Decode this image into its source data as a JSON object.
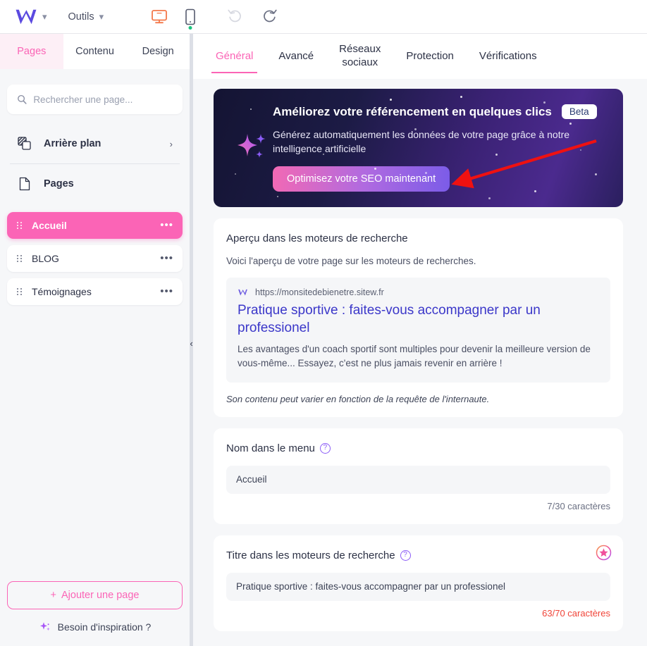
{
  "topbar": {
    "logo": "sitew-w-logo",
    "logo_caret": "⌄",
    "tools_label": "Outils",
    "tools_caret": "⌄",
    "desktop_icon": "desktop-monitor-icon",
    "mobile_icon": "mobile-phone-icon",
    "undo_icon": "undo-arrow-icon",
    "redo_icon": "redo-arrow-icon"
  },
  "sidebar": {
    "tabs": [
      {
        "label": "Pages",
        "active": true
      },
      {
        "label": "Contenu",
        "active": false
      },
      {
        "label": "Design",
        "active": false
      }
    ],
    "search": {
      "placeholder": "Rechercher une page...",
      "value": "",
      "icon": "search-icon"
    },
    "menu": [
      {
        "label": "Arrière plan",
        "icon": "layers-icon",
        "arrow": "›"
      },
      {
        "label": "Pages",
        "icon": "page-document-icon"
      }
    ],
    "pages": [
      {
        "label": "Accueil",
        "active": true,
        "menu_dots": "•••"
      },
      {
        "label": "BLOG",
        "active": false,
        "menu_dots": "•••"
      },
      {
        "label": "Témoignages",
        "active": false,
        "menu_dots": "•••"
      }
    ],
    "add_page_label": "Ajouter une page",
    "add_page_plus": "+",
    "inspiration_label": "Besoin d'inspiration ?",
    "inspiration_icon": "sparkle-icon",
    "collapse_icon": "‹"
  },
  "main": {
    "tabs": [
      {
        "label": "Général",
        "active": true
      },
      {
        "label": "Avancé",
        "active": false
      },
      {
        "label": "Réseaux\nsociaux",
        "active": false
      },
      {
        "label": "Protection",
        "active": false
      },
      {
        "label": "Vérifications",
        "active": false
      }
    ],
    "banner": {
      "title": "Améliorez votre référencement en quelques clics",
      "badge": "Beta",
      "subtitle": "Générez automatiquement les données de votre page grâce à notre intelligence artificielle",
      "cta": "Optimisez votre SEO maintenant",
      "sparkle_icon": "sparkle-stars-icon",
      "annotation_arrow": "red-arrow-annotation"
    },
    "preview_card": {
      "title": "Aperçu dans les moteurs de recherche",
      "subtitle": "Voici l'aperçu de votre page sur les moteurs de recherches.",
      "favicon": "sitew-w-favicon",
      "url": "https://monsitedebienetre.sitew.fr",
      "serp_title": "Pratique sportive : faites-vous accompagner par un professionel",
      "serp_description": "Les avantages d'un coach sportif sont multiples pour devenir la meilleure version de vous-même... Essayez, c'est ne plus jamais revenir en arrière !",
      "note": "Son contenu peut varier en fonction de la requête de l'internaute."
    },
    "menu_name_card": {
      "title": "Nom dans le menu",
      "help_icon": "?",
      "value": "Accueil",
      "counter": "7/30 caractères"
    },
    "seo_title_card": {
      "title": "Titre dans les moteurs de recherche",
      "help_icon": "?",
      "value": "Pratique sportive : faites-vous accompagner par un professionel",
      "counter": "63/70 caractères",
      "premium_icon": "premium-star-icon"
    }
  },
  "colors": {
    "accent_pink": "#fb64b6",
    "logo_purple": "#5b4ae0",
    "counter_warn": "#f04438",
    "annotation_red": "#ef1111",
    "desktop_orange": "#f4784a"
  }
}
